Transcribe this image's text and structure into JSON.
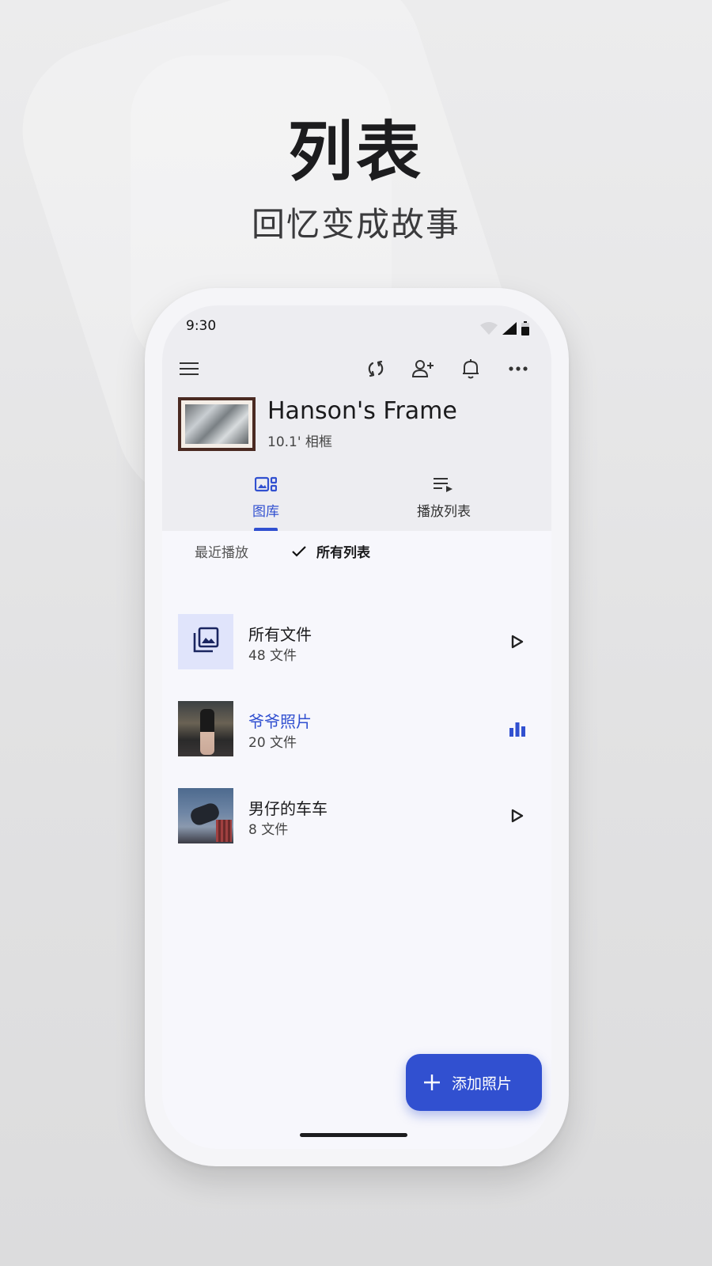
{
  "promo": {
    "headline": "列表",
    "subline": "回忆变成故事"
  },
  "status_bar": {
    "time": "9:30"
  },
  "toolbar": {
    "icons": [
      "menu-icon",
      "sync-icon",
      "add-person-icon",
      "bell-icon",
      "more-icon"
    ]
  },
  "device": {
    "name": "Hanson's Frame",
    "subtitle": "10.1' 相框"
  },
  "tabs": [
    {
      "label": "图库",
      "active": true,
      "icon": "gallery-icon"
    },
    {
      "label": "播放列表",
      "active": false,
      "icon": "playlist-icon"
    }
  ],
  "filters": [
    {
      "label": "最近播放",
      "selected": false
    },
    {
      "label": "所有列表",
      "selected": true
    }
  ],
  "playlists": [
    {
      "title": "所有文件",
      "count": "48 文件",
      "state": "play",
      "playing": false
    },
    {
      "title": "爷爷照片",
      "count": "20 文件",
      "state": "now-playing",
      "playing": true
    },
    {
      "title": "男仔的车车",
      "count": "8 文件",
      "state": "play",
      "playing": false
    }
  ],
  "fab": {
    "label": "添加照片"
  },
  "colors": {
    "accent": "#3150d0",
    "all_files_tile": "#e0e4fb"
  }
}
